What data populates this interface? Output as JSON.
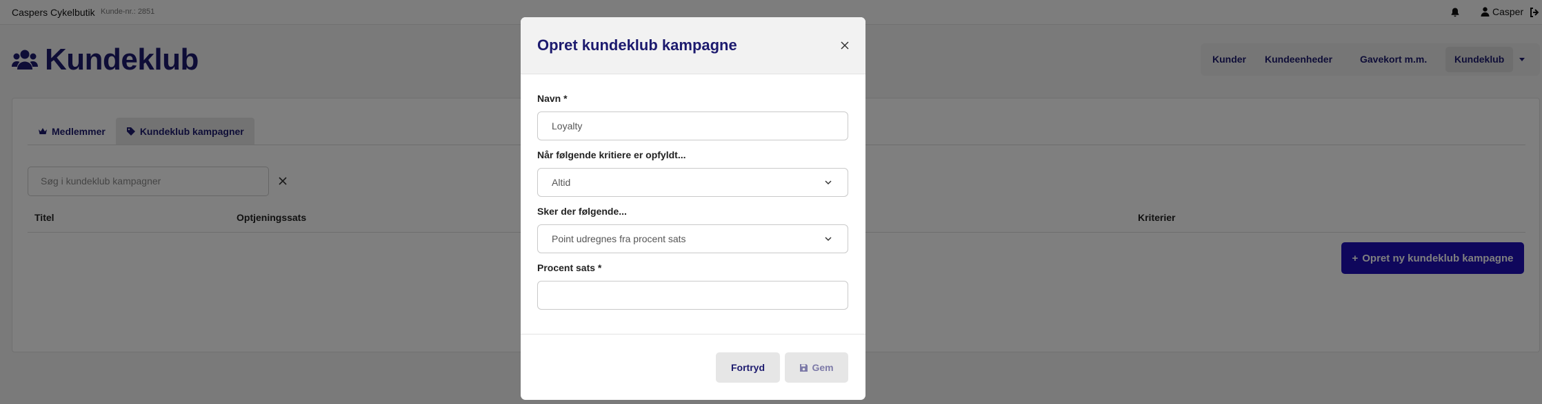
{
  "app": {
    "brand": "Caspers Cykelbutik",
    "customer_number": "Kunde-nr.: 2851",
    "user_name": "Casper"
  },
  "page": {
    "title": "Kundeklub"
  },
  "nav": {
    "items": [
      {
        "label": "Kunder"
      },
      {
        "label": "Kundeenheder"
      },
      {
        "label": "Gavekort m.m."
      },
      {
        "label": "Kundeklub"
      }
    ]
  },
  "tabs": [
    {
      "label": "Medlemmer",
      "icon": "crown-icon"
    },
    {
      "label": "Kundeklub kampagner",
      "icon": "tag-icon"
    }
  ],
  "search": {
    "placeholder": "Søg i kundeklub kampagner"
  },
  "table": {
    "columns": [
      "Titel",
      "Optjeningssats",
      "Kriterier"
    ]
  },
  "actions": {
    "new_campaign": "Opret ny kundeklub kampagne"
  },
  "modal": {
    "title": "Opret kundeklub kampagne",
    "name_label": "Navn *",
    "name_value": "Loyalty",
    "criteria_label": "Når følgende kritiere er opfyldt...",
    "criteria_value": "Altid",
    "action_label": "Sker der følgende...",
    "action_value": "Point udregnes fra procent sats",
    "percent_label": "Procent sats *",
    "percent_value": "",
    "cancel_label": "Fortryd",
    "save_label": "Gem"
  },
  "colors": {
    "brand_navy": "#1c1a6e",
    "primary_button": "#1f0fb8"
  }
}
